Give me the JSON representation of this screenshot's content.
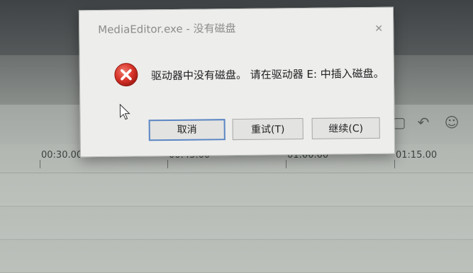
{
  "dialog": {
    "title": "MediaEditor.exe - 没有磁盘",
    "message": "驱动器中没有磁盘。 请在驱动器 E: 中插入磁盘。",
    "buttons": {
      "cancel": "取消",
      "retry": "重试(T)",
      "continue": "继续(C)"
    },
    "icons": {
      "error": "error-icon",
      "close": "close-icon"
    }
  },
  "timeline": {
    "ticks": [
      "00:30.00",
      "00:45.00",
      "01:00.00",
      "01:15.00"
    ]
  },
  "colors": {
    "error_red": "#d9352b",
    "dialog_bg": "#ededeb",
    "primary_border": "#5b86c4"
  }
}
